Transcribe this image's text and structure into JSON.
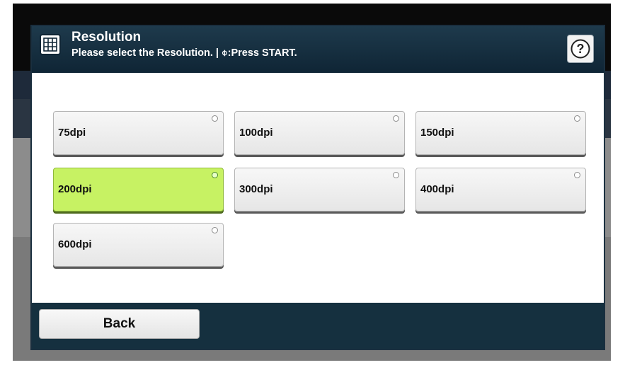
{
  "dialog": {
    "title": "Resolution",
    "subtitle": "Please select the Resolution. | ⌽:Press START.",
    "header_icon": "grid-icon",
    "help_icon": "help-icon"
  },
  "options": [
    {
      "label": "75dpi",
      "selected": false
    },
    {
      "label": "100dpi",
      "selected": false
    },
    {
      "label": "150dpi",
      "selected": false
    },
    {
      "label": "200dpi",
      "selected": true
    },
    {
      "label": "300dpi",
      "selected": false
    },
    {
      "label": "400dpi",
      "selected": false
    },
    {
      "label": "600dpi",
      "selected": false
    }
  ],
  "footer": {
    "back_label": "Back"
  },
  "colors": {
    "header": "#1e3a4c",
    "selected": "#c7f263",
    "footer": "#15303f"
  }
}
